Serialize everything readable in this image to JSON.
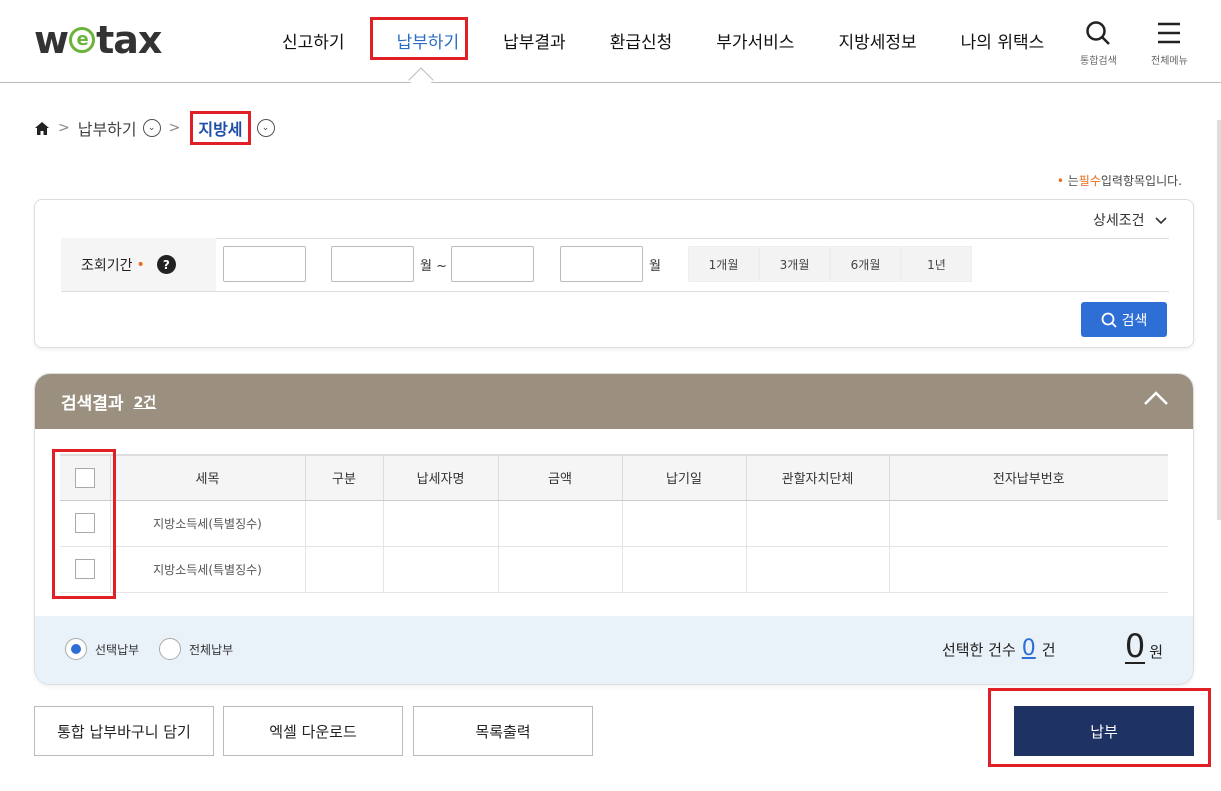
{
  "header": {
    "logo": {
      "pre": "w",
      "e": "e",
      "post": "tax"
    },
    "nav": [
      "신고하기",
      "납부하기",
      "납부결과",
      "환급신청",
      "부가서비스",
      "지방세정보",
      "나의 위택스"
    ],
    "search_label": "통합검색",
    "menu_label": "전체메뉴"
  },
  "breadcrumb": {
    "parent": "납부하기",
    "current": "지방세"
  },
  "required_note": {
    "dot": "•",
    "pre": "는",
    "word": "필수",
    "post": "입력항목입니다."
  },
  "search": {
    "detail_label": "상세조건",
    "period_label": "조회기간",
    "month_unit": "월 ~",
    "month_unit2": "월",
    "quick": [
      "1개월",
      "3개월",
      "6개월",
      "1년"
    ],
    "button": "검색"
  },
  "result": {
    "title": "검색결과",
    "count": "2건",
    "columns": [
      "세목",
      "구분",
      "납세자명",
      "금액",
      "납기일",
      "관할자치단체",
      "전자납부번호"
    ],
    "rows": [
      {
        "tax": "지방소득세(특별징수)"
      },
      {
        "tax": "지방소득세(특별징수)"
      }
    ],
    "radio_selected": "선택납부",
    "radio_all": "전체납부",
    "selected_label": "선택한 건수",
    "selected_num": "0",
    "selected_unit": "건",
    "amount_num": "0",
    "amount_unit": "원"
  },
  "buttons": {
    "cart": "통합 납부바구니 담기",
    "excel": "엑셀 다운로드",
    "print": "목록출력",
    "pay": "납부"
  }
}
